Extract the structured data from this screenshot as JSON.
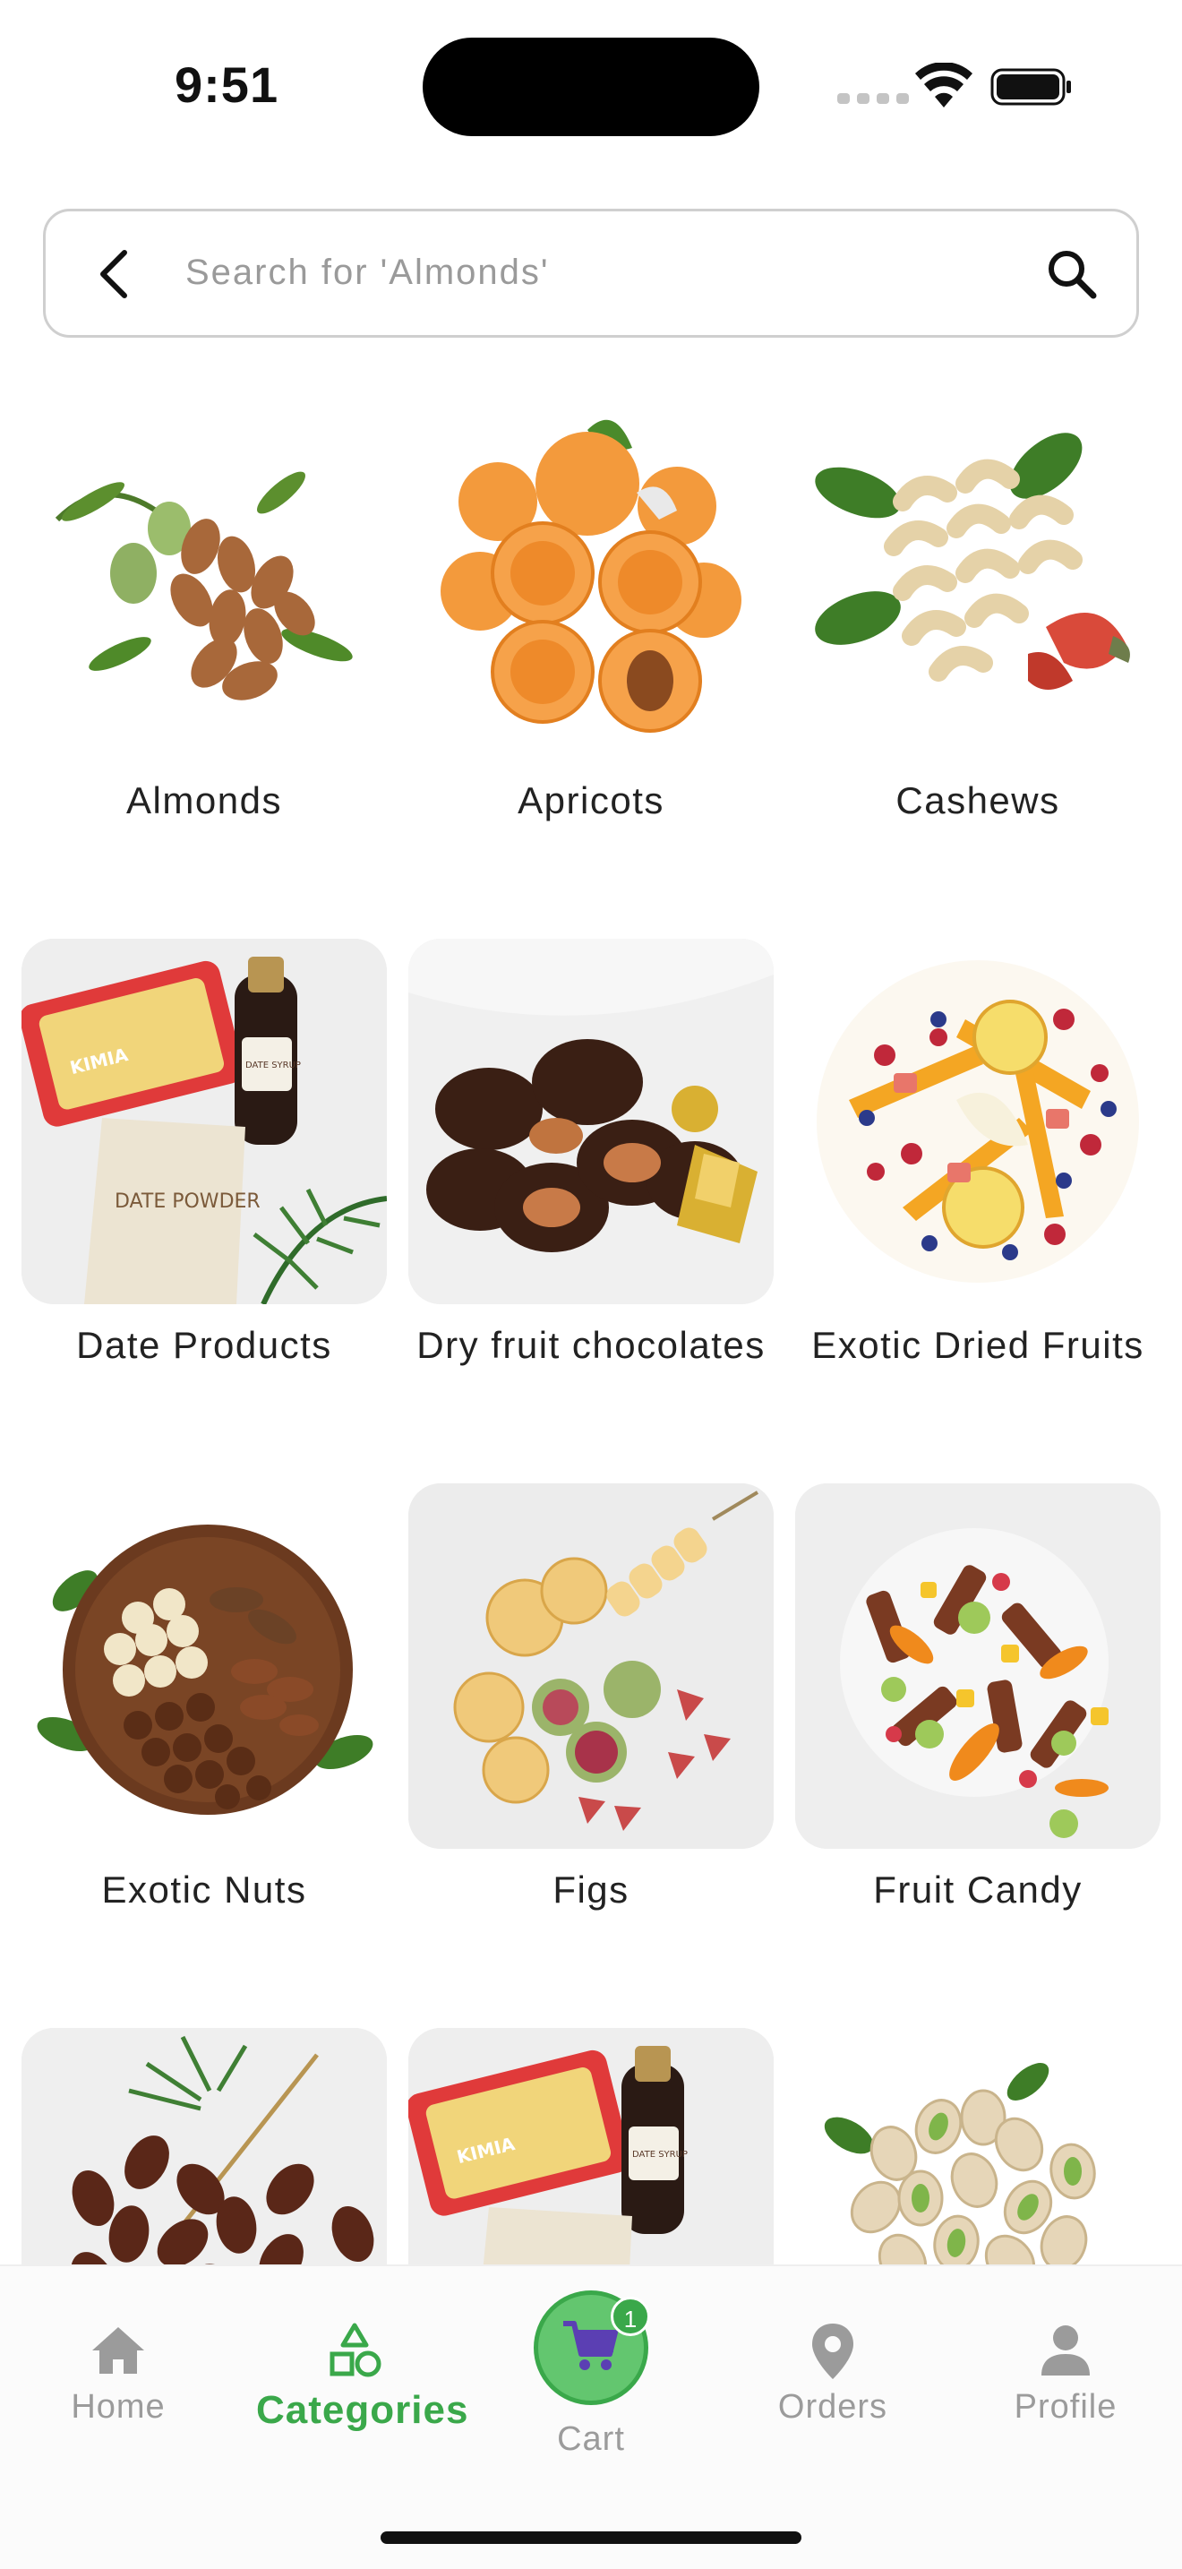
{
  "status_bar": {
    "time": "9:51"
  },
  "search": {
    "placeholder": "Search for 'Almonds'"
  },
  "categories": [
    {
      "label": "Almonds"
    },
    {
      "label": "Apricots"
    },
    {
      "label": "Cashews"
    },
    {
      "label": "Date Products"
    },
    {
      "label": "Dry fruit chocolates"
    },
    {
      "label": "Exotic Dried Fruits"
    },
    {
      "label": "Exotic Nuts"
    },
    {
      "label": "Figs"
    },
    {
      "label": "Fruit Candy"
    },
    {
      "label": ""
    },
    {
      "label": ""
    },
    {
      "label": ""
    }
  ],
  "nav": {
    "home": "Home",
    "categories": "Categories",
    "cart": "Cart",
    "cart_count": "1",
    "orders": "Orders",
    "profile": "Profile"
  },
  "colors": {
    "accent": "#3aa84a",
    "cart_bg": "#63c66f",
    "cart_icon": "#5b3fb3"
  },
  "package_text": {
    "brand": "KIMIA",
    "syrup": "DATE SYRUP",
    "powder": "DATE POWDER"
  }
}
